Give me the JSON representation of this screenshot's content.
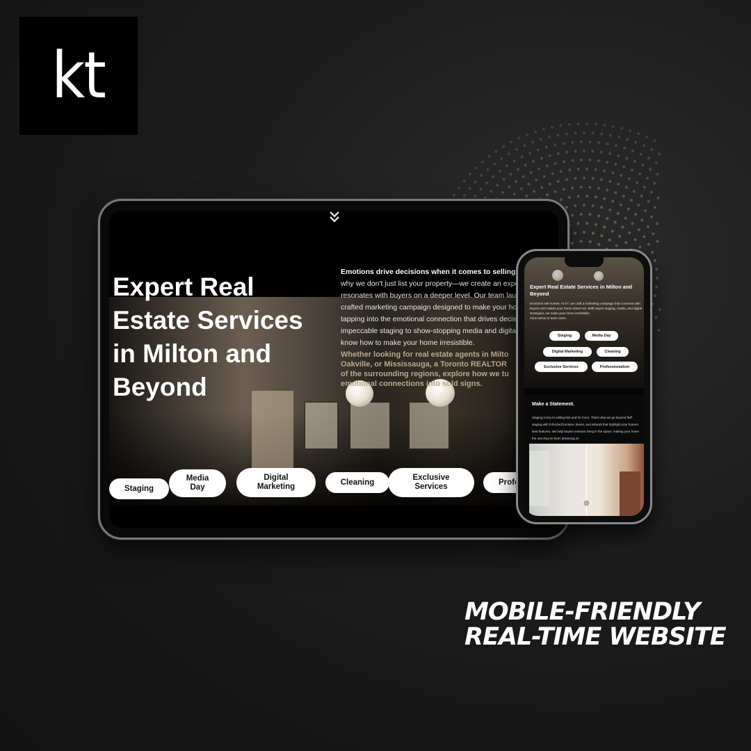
{
  "brand": {
    "logo_text": "kt"
  },
  "tablet": {
    "hero_title": "Expert Real Estate Services in Milton and Beyond",
    "intro_lines": [
      "Emotions drive decisions when it comes to selling a ho",
      "why we don't just list your property—we create an experienc",
      "resonates with buyers on a deeper level. Our team launche",
      "crafted marketing campaign designed to make your home s",
      "tapping into the emotional connection that drives decision-r",
      "impeccable staging to show-stopping media and digital stra",
      "know how to make your home irresistible."
    ],
    "region_lines": [
      "Whether looking for real estate agents in Milto",
      "Oakville, or Mississauga, a Toronto REALTOR",
      "of the surrounding regions, explore how we tu",
      "emotional connections into sold signs."
    ],
    "services": [
      "Staging",
      "Media Day",
      "Digital Marketing",
      "Cleaning",
      "Exclusive Services",
      "Profe"
    ]
  },
  "phone": {
    "hero_title": "Expert Real Estate Services in Milton and Beyond",
    "hero_body": "Emotions sell homes. At KT, we craft a marketing campaign that connects with buyers and makes your home stand out. With expert staging, media, and digital strategies, we make your home irresistible.",
    "hero_cta": "Click below to learn more.",
    "services": [
      "Staging",
      "Media Day",
      "Digital Marketing",
      "Cleaning",
      "Exclusive Services",
      "Professionalism"
    ],
    "section_title": "Make a Statement.",
    "section_body": "Staging is key to selling fast and for more. That's why we go beyond fluff staging with full-sized furniture, linens, and artwork that highlight your home's best features. We help buyers envision living in the space, making your home the one they've been dreaming of."
  },
  "tagline": {
    "line1": "MOBILE-FRIENDLY",
    "line2": "REAL-TIME WEBSITE"
  },
  "colors": {
    "background": "#1c1c1c",
    "accent_gold": "#b8a98c",
    "pill_bg": "#ffffff"
  },
  "icons": {
    "tablet_scroll": "double-chevron-down-icon",
    "phone_photo_slider": "slider-handle-icon"
  }
}
